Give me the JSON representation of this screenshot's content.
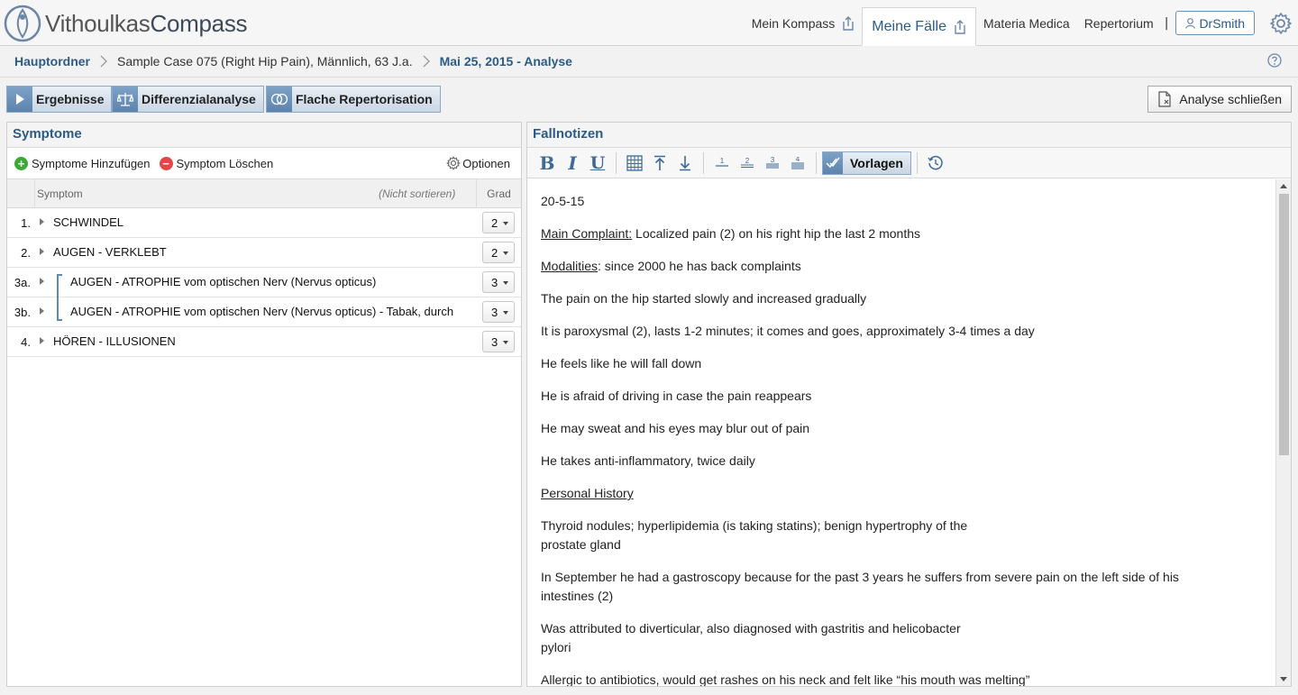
{
  "brand": {
    "light": "Vithoulkas",
    "bold": "Compass"
  },
  "nav": {
    "mein_kompass": "Mein Kompass",
    "meine_faelle": "Meine Fälle",
    "materia_medica": "Materia Medica",
    "repertorium": "Repertorium",
    "separator": "|",
    "user": "DrSmith"
  },
  "breadcrumb": {
    "root": "Hauptordner",
    "case": "Sample Case 075 (Right Hip Pain), Männlich, 63 J.a.",
    "current": "Mai 25, 2015 - Analyse"
  },
  "toolbar": {
    "ergebnisse": "Ergebnisse",
    "differenzialanalyse": "Differenzialanalyse",
    "flache": "Flache Repertorisation",
    "close": "Analyse schließen"
  },
  "symptoms": {
    "title": "Symptome",
    "add": "Symptome Hinzufügen",
    "delete": "Symptom Löschen",
    "options": "Optionen",
    "col_symptom": "Symptom",
    "col_nosort": "(Nicht sortieren)",
    "col_grad": "Grad",
    "rows": [
      {
        "num": "1.",
        "text": "SCHWINDEL",
        "grade": "2"
      },
      {
        "num": "2.",
        "text": "AUGEN - VERKLEBT",
        "grade": "2"
      },
      {
        "num": "3a.",
        "text": "AUGEN - ATROPHIE vom optischen Nerv (Nervus opticus)",
        "grade": "3"
      },
      {
        "num": "3b.",
        "text": "AUGEN - ATROPHIE vom optischen Nerv (Nervus opticus) - Tabak, durch",
        "grade": "3"
      },
      {
        "num": "4.",
        "text": "HÖREN - ILLUSIONEN",
        "grade": "3"
      }
    ]
  },
  "notes": {
    "title": "Fallnotizen",
    "vorlagen": "Vorlagen",
    "heading_sizes": [
      "1",
      "2",
      "3",
      "4"
    ],
    "date": "20-5-15",
    "main_label": "Main Complaint:",
    "main_text": " Localized pain (2) on his right hip the last 2 months",
    "mod_label": "Modalities",
    "mod_text": ": since 2000 he has back complaints",
    "p1": "The pain on the hip started slowly and increased gradually",
    "p2": "It is paroxysmal (2), lasts 1-2 minutes; it comes and goes, approximately 3-4 times a day",
    "p3": "He feels like he will fall down",
    "p4": "He is afraid of driving in case the pain reappears",
    "p5": "He may sweat and his eyes may blur out of pain",
    "p6": "He takes anti-inflammatory, twice daily",
    "personal": "Personal History",
    "p7a": "Thyroid nodules; hyperlipidemia (is taking statins); benign hypertrophy of the",
    "p7b": "prostate gland",
    "p8a": "In September he had a gastroscopy because for the past 3 years he suffers from severe pain on the left side of his",
    "p8b": "intestines (2)",
    "p9a": "Was attributed to diverticular, also diagnosed with gastritis and helicobacter",
    "p9b": "pylori",
    "p10": "Allergic to antibiotics, would get rashes on his neck and felt like “his mouth was melting”"
  },
  "colors": {
    "accent": "#2b5b86",
    "button_blue": "#5d84ae",
    "add_green": "#3aaa35",
    "delete_red": "#e04848"
  }
}
